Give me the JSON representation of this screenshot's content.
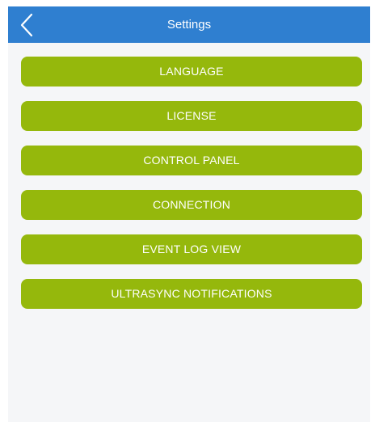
{
  "header": {
    "title": "Settings"
  },
  "menu": {
    "items": [
      {
        "label": "LANGUAGE"
      },
      {
        "label": "LICENSE"
      },
      {
        "label": "CONTROL PANEL"
      },
      {
        "label": "CONNECTION"
      },
      {
        "label": "EVENT LOG VIEW"
      },
      {
        "label": "ULTRASYNC NOTIFICATIONS"
      }
    ]
  },
  "colors": {
    "header_bg": "#2f7fd0",
    "button_bg": "#95b80c",
    "screen_bg": "#f5f6f8"
  },
  "icons": {
    "back": "chevron-left-icon"
  }
}
